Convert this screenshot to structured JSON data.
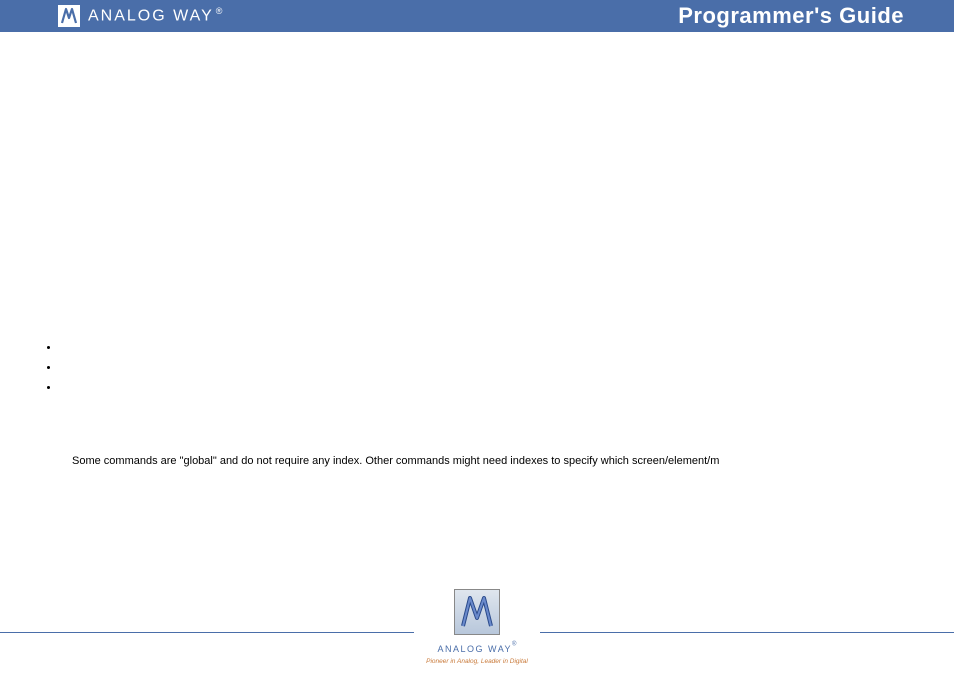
{
  "header": {
    "brand": "ANALOG WAY",
    "brand_mark": "®",
    "title": "Programmer's Guide"
  },
  "content": {
    "bullets": [
      "",
      "",
      ""
    ],
    "paragraph": "Some commands are \"global\" and do not require any index. Other commands might need indexes to specify  which screen/element/m"
  },
  "footer": {
    "brand": "ANALOG WAY",
    "brand_mark": "®",
    "tagline": "Pioneer in Analog, Leader in Digital"
  }
}
